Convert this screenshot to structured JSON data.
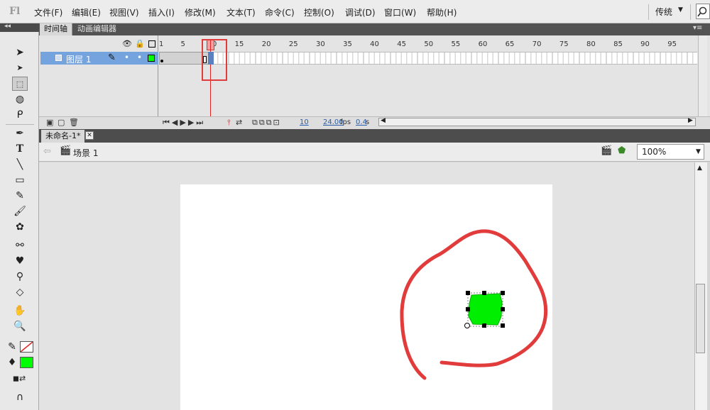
{
  "app": {
    "logo": "Fl"
  },
  "menu": [
    "文件(F)",
    "编辑(E)",
    "视图(V)",
    "插入(I)",
    "修改(M)",
    "文本(T)",
    "命令(C)",
    "控制(O)",
    "调试(D)",
    "窗口(W)",
    "帮助(H)"
  ],
  "workspace": {
    "label": "传统"
  },
  "panels": {
    "timeline_tab": "时间轴",
    "motion_editor_tab": "动画编辑器"
  },
  "timeline": {
    "frame_numbers": [
      "1",
      "5",
      "10",
      "15",
      "20",
      "25",
      "30",
      "35",
      "40",
      "45",
      "50",
      "55",
      "60",
      "65",
      "70",
      "75",
      "80",
      "85",
      "90",
      "95"
    ],
    "layer_name": "图层 1",
    "current_frame": "10",
    "fps": "24.00",
    "fps_unit": "fps",
    "time": "0.4",
    "time_unit": "s"
  },
  "document": {
    "tab_title": "未命名-1*",
    "close_glyph": "✕"
  },
  "editbar": {
    "scene": "场景 1",
    "zoom": "100%"
  },
  "colors": {
    "stroke": "none",
    "fill": "#00ff00",
    "shape_fill": "#00ee00",
    "annotation": "#e23b3b",
    "layer_highlight": "#74a3dd"
  }
}
